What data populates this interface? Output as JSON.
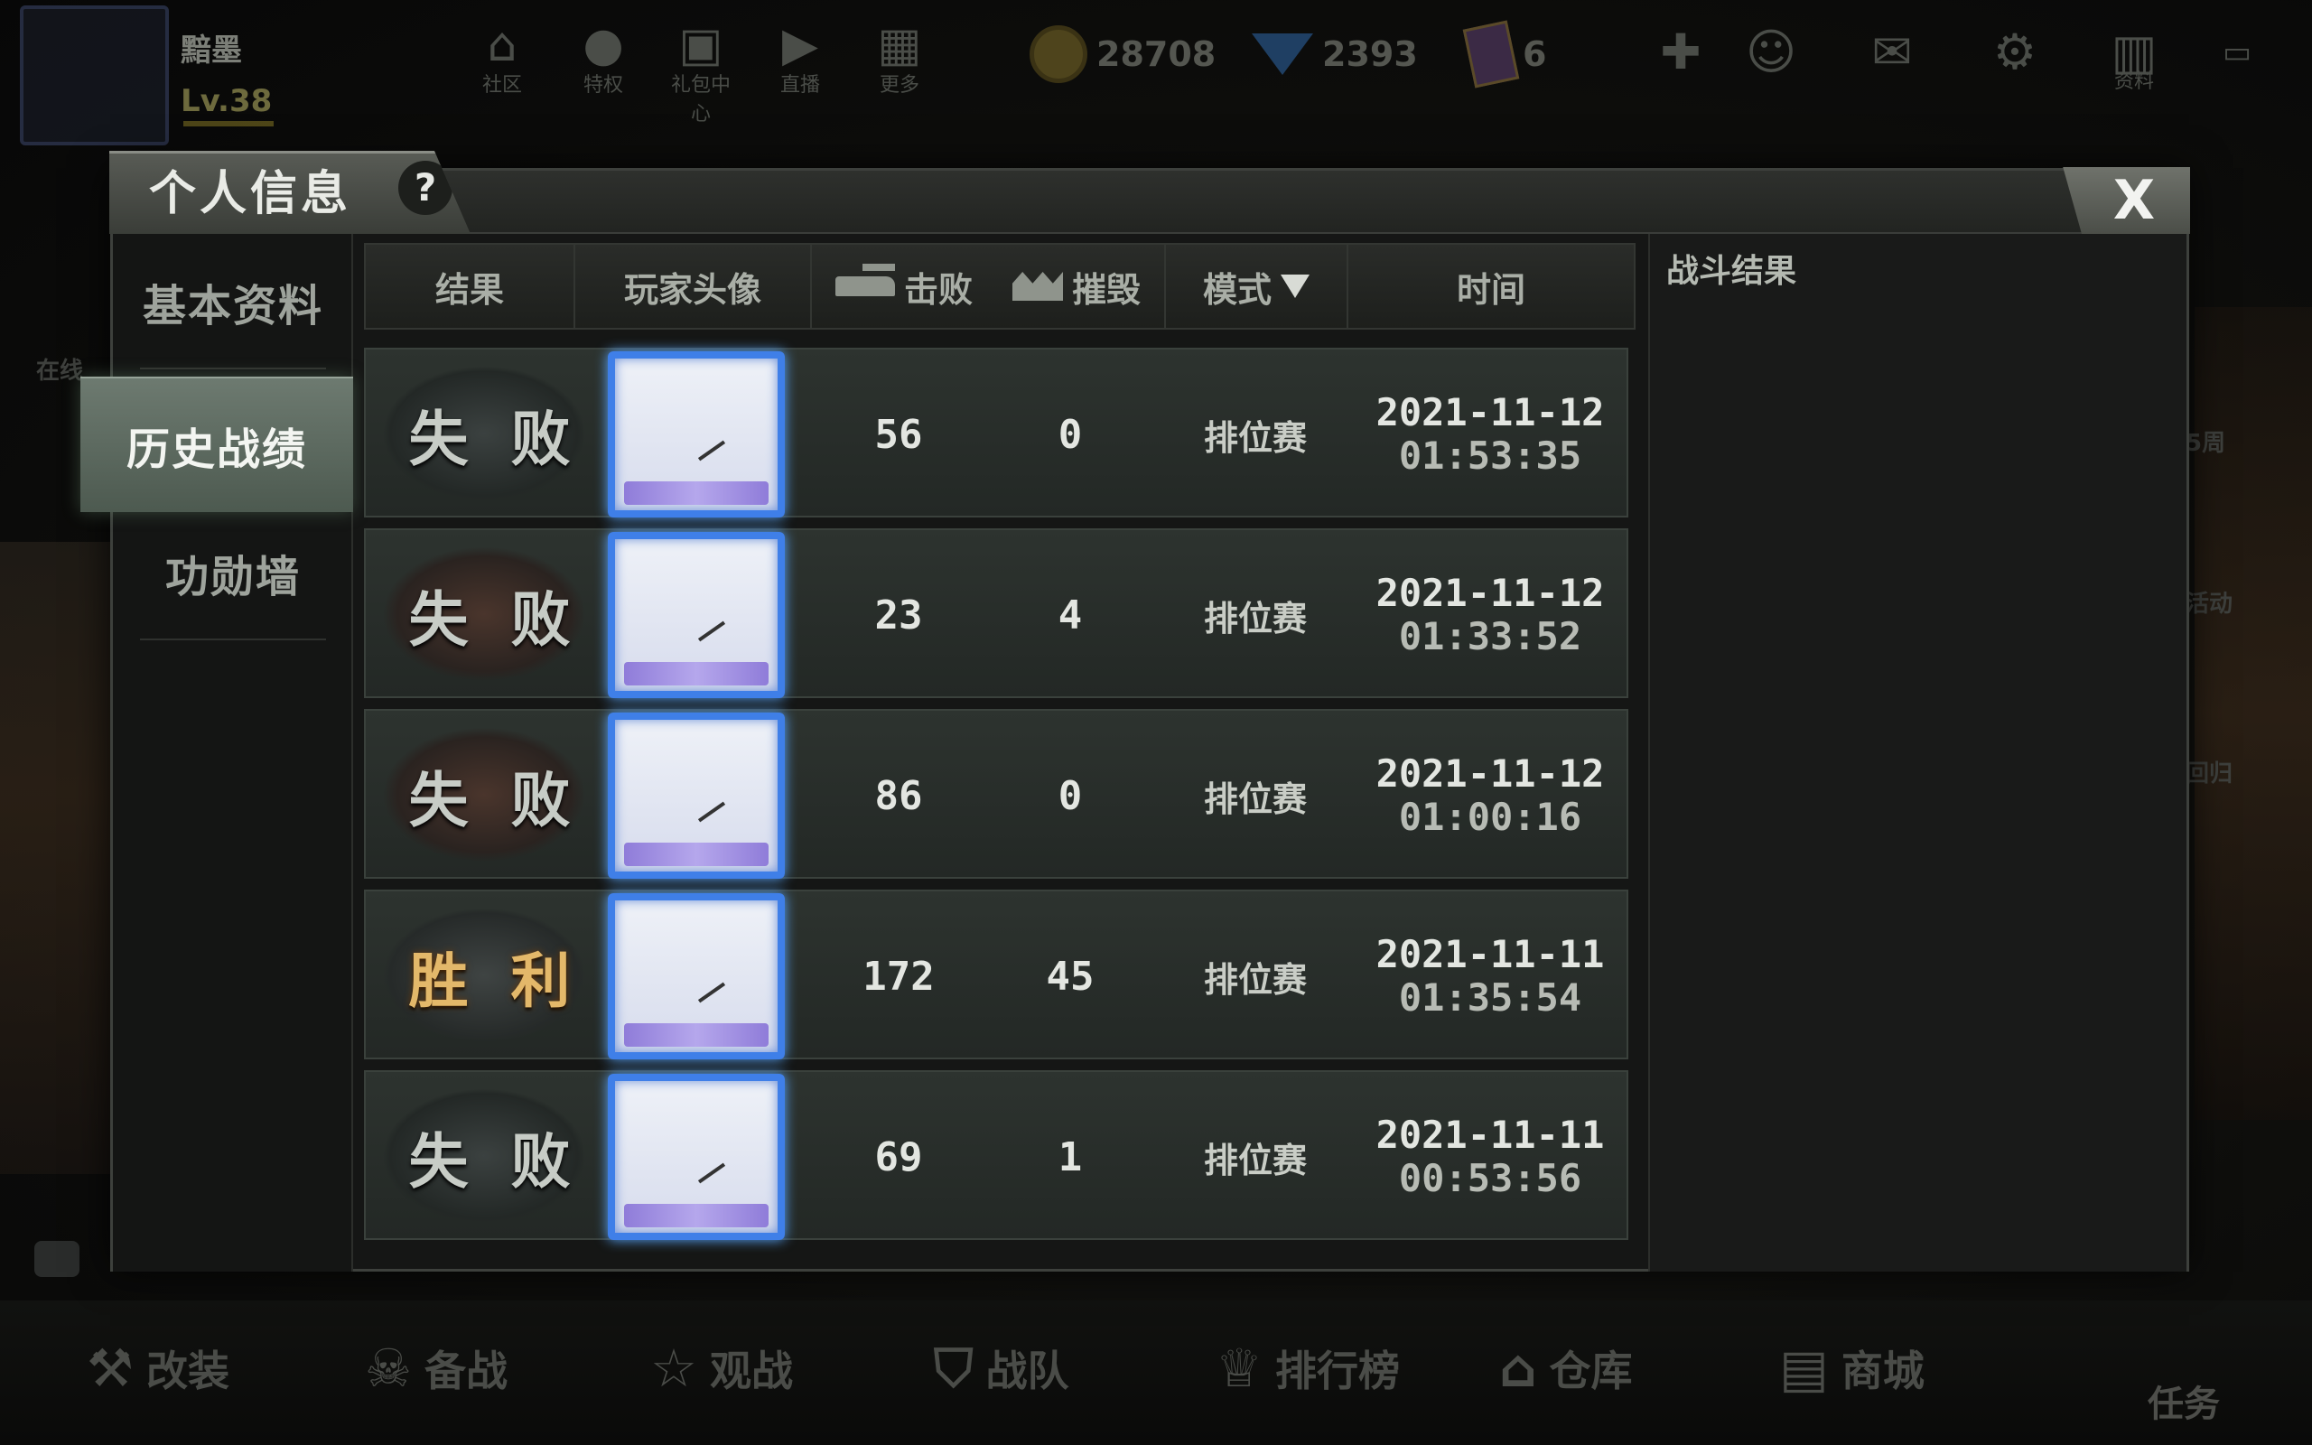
{
  "hud": {
    "player_name": "黯墨",
    "player_level": "Lv.38",
    "top_icons": [
      {
        "label": "社区",
        "icon": "home-icon"
      },
      {
        "label": "特权",
        "icon": "penguin-icon"
      },
      {
        "label": "礼包中心",
        "icon": "gift-icon"
      },
      {
        "label": "直播",
        "icon": "play-icon"
      },
      {
        "label": "更多",
        "icon": "grid-icon"
      }
    ],
    "currency": {
      "gold": "28708",
      "diamond": "2393",
      "cards": "6"
    },
    "right_icons": [
      {
        "label": "",
        "icon": "plus-icon"
      },
      {
        "label": "",
        "icon": "friends-icon"
      },
      {
        "label": "",
        "icon": "mail-icon"
      },
      {
        "label": "",
        "icon": "gear-icon"
      },
      {
        "label": "资料",
        "icon": "book-icon"
      }
    ],
    "side_labels": {
      "left_online": "在线",
      "right_week": "5周",
      "right_event": "活动",
      "right_return": "回归"
    },
    "bottom_nav": [
      {
        "label": "改装",
        "icon": "wrench-icon"
      },
      {
        "label": "备战",
        "icon": "gasmask-icon"
      },
      {
        "label": "观战",
        "icon": "star-icon"
      },
      {
        "label": "战队",
        "icon": "shield-icon"
      },
      {
        "label": "排行榜",
        "icon": "trophy-icon"
      },
      {
        "label": "仓库",
        "icon": "warehouse-icon"
      },
      {
        "label": "商城",
        "icon": "shop-icon"
      }
    ],
    "task_label": "任务"
  },
  "modal": {
    "title": "个人信息",
    "help_label": "?",
    "close_label": "X",
    "nav": [
      {
        "label": "基本资料",
        "active": false
      },
      {
        "label": "历史战绩",
        "active": true
      },
      {
        "label": "功勋墙",
        "active": false
      }
    ],
    "table": {
      "headers": {
        "result": "结果",
        "avatar": "玩家头像",
        "kills": "击败",
        "destroys": "摧毁",
        "mode": "模式",
        "time": "时间"
      },
      "rows": [
        {
          "result": "失 败",
          "kills": "56",
          "destroys": "0",
          "mode": "排位赛",
          "date": "2021-11-12",
          "time": "01:53:35",
          "win": false
        },
        {
          "result": "失 败",
          "kills": "23",
          "destroys": "4",
          "mode": "排位赛",
          "date": "2021-11-12",
          "time": "01:33:52",
          "win": false
        },
        {
          "result": "失 败",
          "kills": "86",
          "destroys": "0",
          "mode": "排位赛",
          "date": "2021-11-12",
          "time": "01:00:16",
          "win": false
        },
        {
          "result": "胜 利",
          "kills": "172",
          "destroys": "45",
          "mode": "排位赛",
          "date": "2021-11-11",
          "time": "01:35:54",
          "win": true
        },
        {
          "result": "失 败",
          "kills": "69",
          "destroys": "1",
          "mode": "排位赛",
          "date": "2021-11-11",
          "time": "00:53:56",
          "win": false
        }
      ]
    },
    "right_panel_title": "战斗结果"
  }
}
